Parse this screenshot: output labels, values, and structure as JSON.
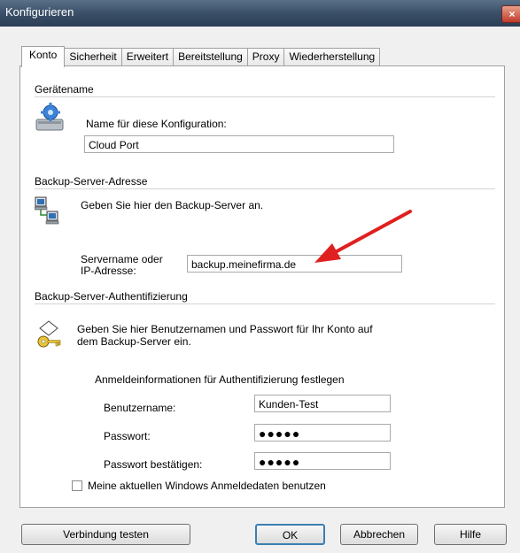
{
  "window": {
    "title": "Konfigurieren",
    "close_glyph": "×"
  },
  "tabs": [
    {
      "label": "Konto",
      "active": true
    },
    {
      "label": "Sicherheit"
    },
    {
      "label": "Erweitert"
    },
    {
      "label": "Bereitstellung"
    },
    {
      "label": "Proxy"
    },
    {
      "label": "Wiederherstellung"
    }
  ],
  "device_section": {
    "title": "Gerätename",
    "icon": "computer-gear-icon",
    "field_label": "Name für diese Konfiguration:",
    "field_value": "Cloud Port"
  },
  "server_section": {
    "title": "Backup-Server-Adresse",
    "icon": "network-computers-icon",
    "description": "Geben Sie hier den Backup-Server an.",
    "field_label_line1": "Servername oder",
    "field_label_line2": "IP-Adresse:",
    "field_value": "backup.meinefirma.de",
    "annotation": "red-arrow-icon"
  },
  "auth_section": {
    "title": "Backup-Server-Authentifizierung",
    "icon": "key-icon",
    "description_line1": "Geben Sie hier Benutzernamen und Passwort für Ihr Konto auf",
    "description_line2": "dem Backup-Server ein.",
    "group_label": "Anmeldeinformationen für Authentifizierung festlegen",
    "username_label": "Benutzername:",
    "username_value": "Kunden-Test",
    "password_label": "Passwort:",
    "password_value": "●●●●●",
    "confirm_label": "Passwort bestätigen:",
    "confirm_value": "●●●●●",
    "checkbox_label": "Meine aktuellen Windows Anmeldedaten benutzen",
    "checkbox_checked": false
  },
  "buttons": {
    "test": "Verbindung testen",
    "ok": "OK",
    "cancel": "Abbrechen",
    "help": "Hilfe"
  },
  "colors": {
    "annotation_red": "#e02020",
    "accent_border": "#3c7fb1"
  }
}
